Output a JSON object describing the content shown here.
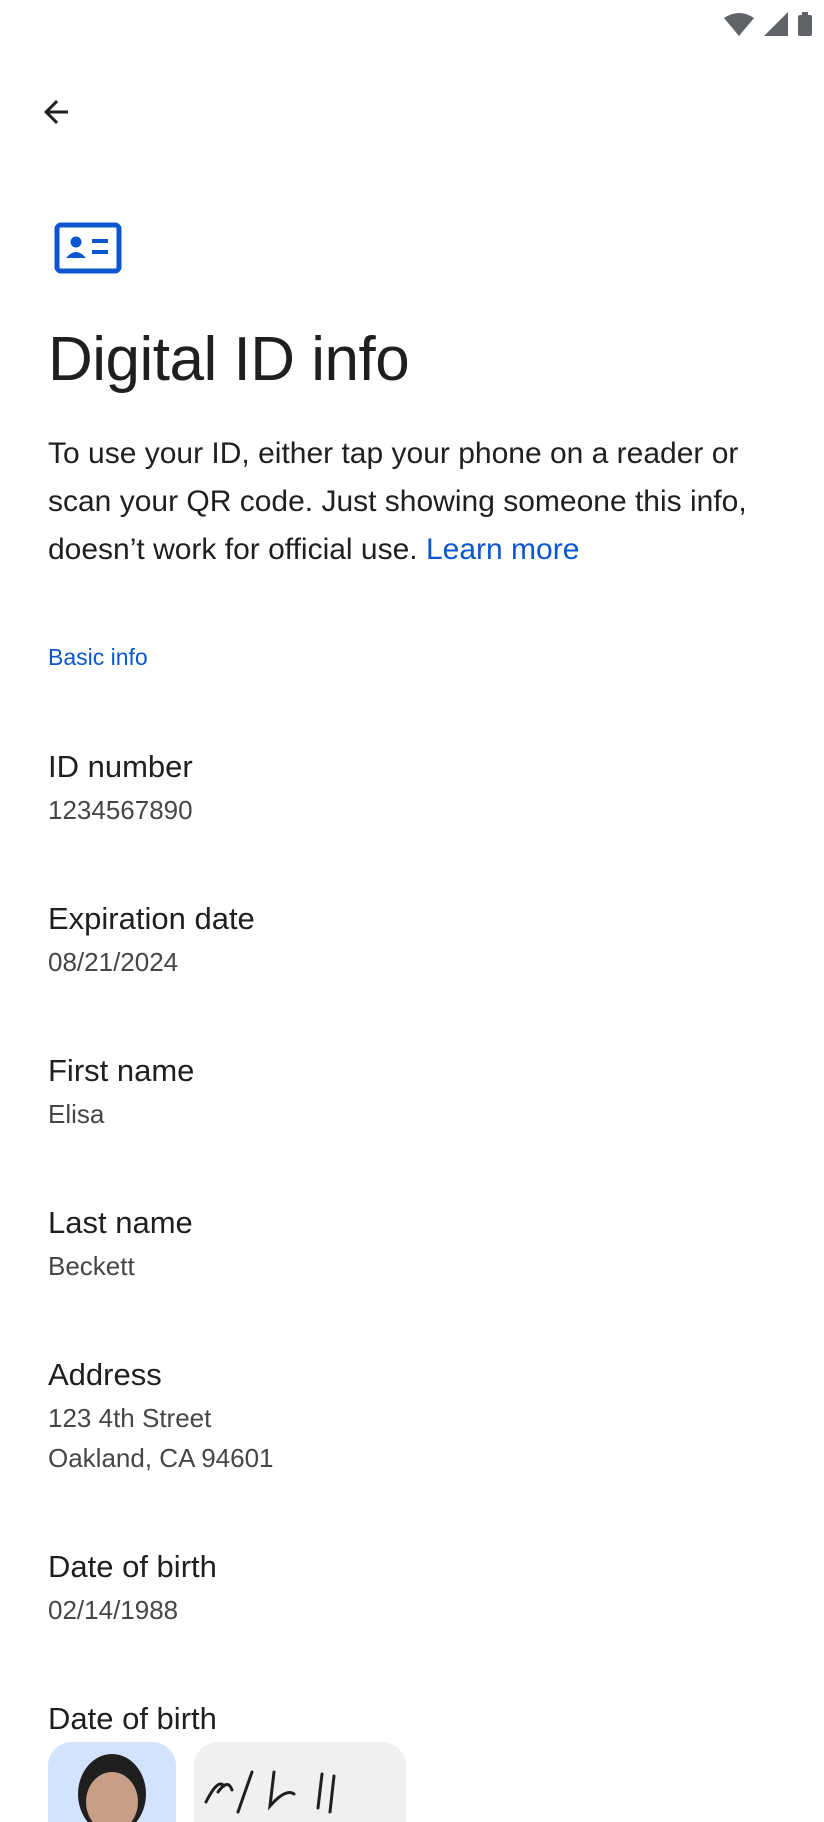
{
  "header": {
    "back_label": "Back"
  },
  "page": {
    "title": "Digital ID info",
    "description": "To use your ID, either tap your phone on a reader or scan your QR code. Just showing someone this info, doesn’t work for official use.",
    "learn_more": "Learn more"
  },
  "section": {
    "title": "Basic info"
  },
  "fields": {
    "id_number": {
      "label": "ID number",
      "value": "1234567890"
    },
    "expiration": {
      "label": "Expiration date",
      "value": "08/21/2024"
    },
    "first_name": {
      "label": "First name",
      "value": "Elisa"
    },
    "last_name": {
      "label": "Last name",
      "value": "Beckett"
    },
    "address": {
      "label": "Address",
      "line1": "123 4th Street",
      "line2": "Oakland, CA 94601"
    },
    "dob": {
      "label": "Date of birth",
      "value": "02/14/1988"
    },
    "dob2": {
      "label": "Date of birth"
    }
  },
  "colors": {
    "accent": "#0b57d0",
    "text": "#1f1f1f",
    "secondary_text": "#444746"
  },
  "icons": {
    "wifi": "wifi-icon",
    "signal": "signal-icon",
    "battery": "battery-icon",
    "back": "arrow-back-icon",
    "id_card": "id-card-icon"
  }
}
